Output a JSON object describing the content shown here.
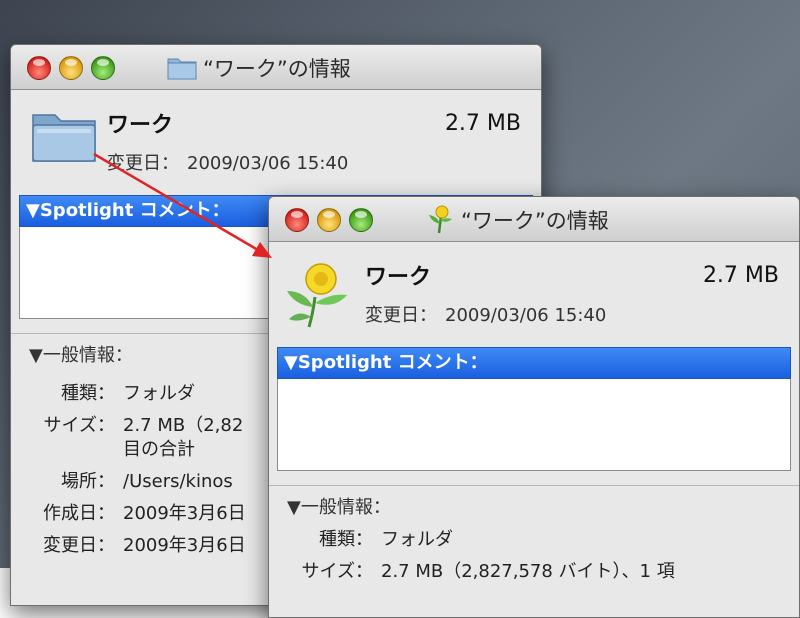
{
  "desktop": {
    "background": "#5c6672"
  },
  "window_back": {
    "title": "“ワーク”の情報",
    "name": "ワーク",
    "size": "2.7 MB",
    "modified_label": "変更日：",
    "modified_value": "2009/03/06 15:40",
    "spotlight_header": "▼Spotlight コメント：",
    "general_header": "▼一般情報：",
    "rows": [
      {
        "key": "種類：",
        "value": "フォルダ"
      },
      {
        "key": "サイズ：",
        "value": "2.7 MB（2,82"
      },
      {
        "key": "",
        "value": "目の合計"
      },
      {
        "key": "場所：",
        "value": "/Users/kinos"
      },
      {
        "key": "作成日：",
        "value": "2009年3月6日"
      },
      {
        "key": "変更日：",
        "value": "2009年3月6日"
      }
    ],
    "icon": "folder-icon"
  },
  "window_front": {
    "title": "“ワーク”の情報",
    "name": "ワーク",
    "size": "2.7 MB",
    "modified_label": "変更日：",
    "modified_value": "2009/03/06 15:40",
    "spotlight_header": "▼Spotlight コメント：",
    "general_header": "▼一般情報：",
    "rows": [
      {
        "key": "種類：",
        "value": "フォルダ"
      },
      {
        "key": "サイズ：",
        "value": "2.7 MB（2,827,578 バイト）、1 項"
      }
    ],
    "icon": "flower-icon"
  },
  "annotation": {
    "arrow_color": "#e02424"
  }
}
